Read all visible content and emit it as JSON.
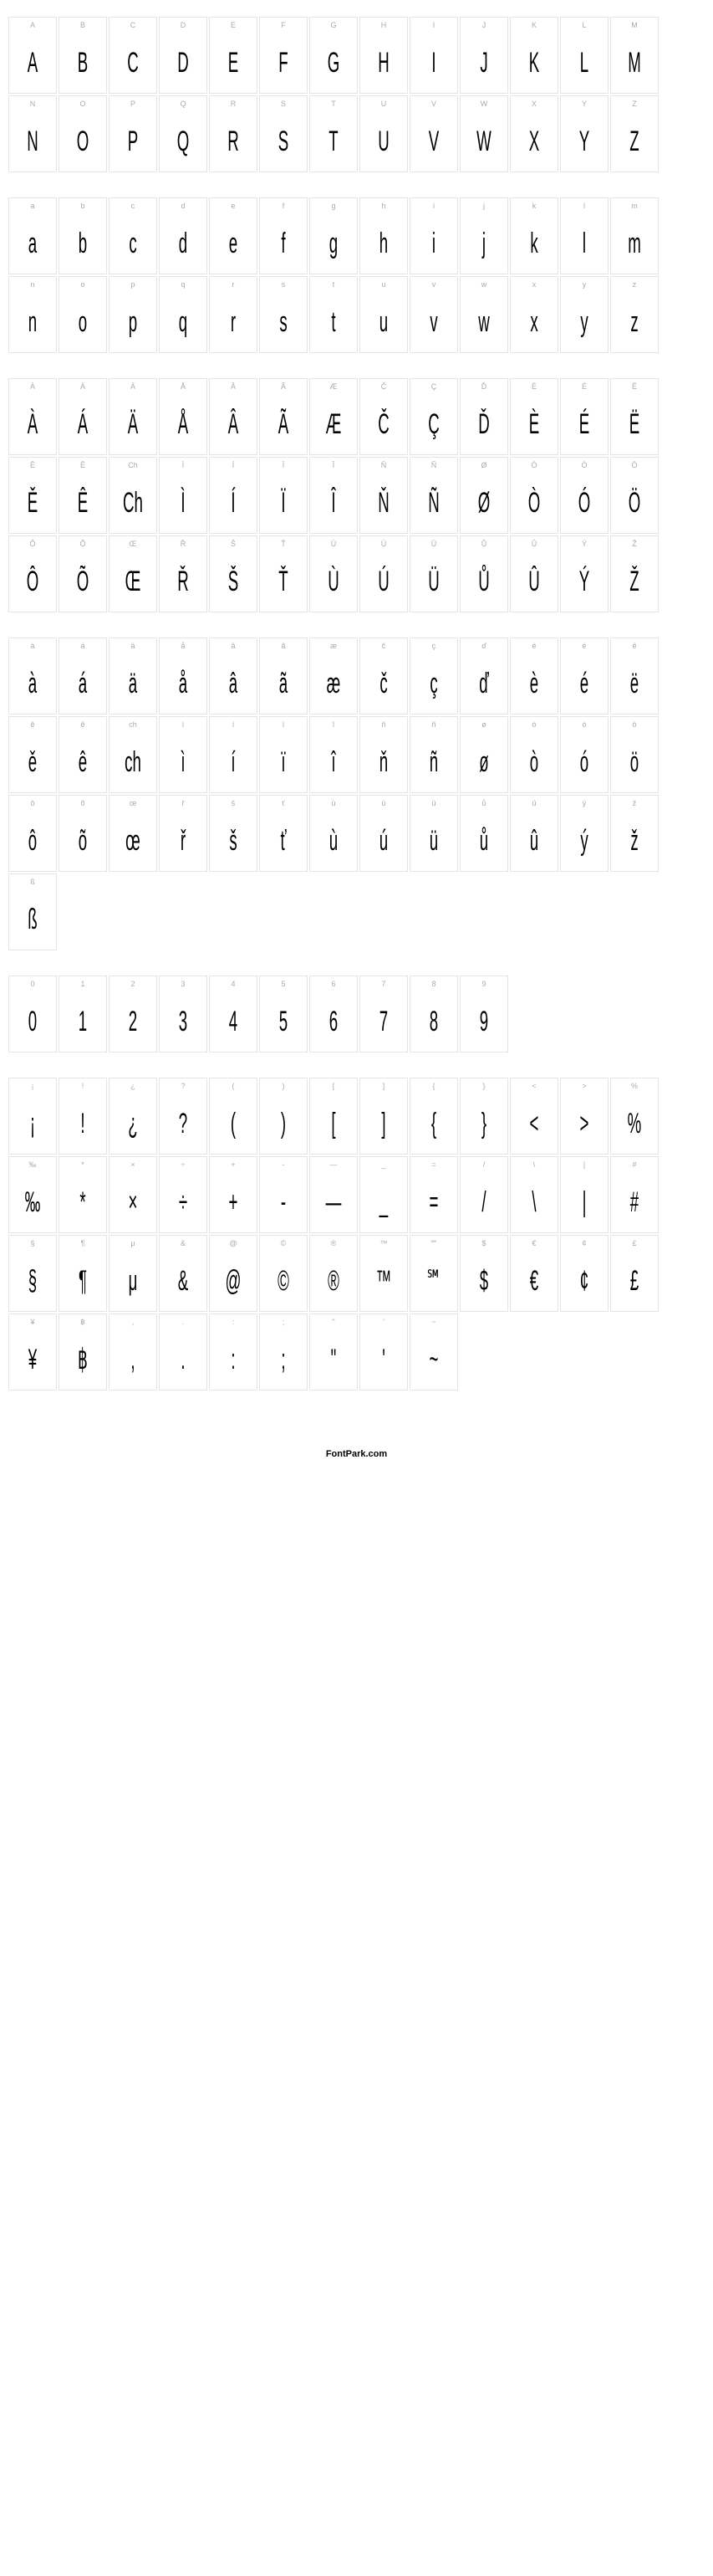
{
  "footer": "FontPark.com",
  "sections": [
    {
      "name": "uppercase",
      "chars": [
        {
          "label": "A",
          "glyph": "A"
        },
        {
          "label": "B",
          "glyph": "B"
        },
        {
          "label": "C",
          "glyph": "C"
        },
        {
          "label": "D",
          "glyph": "D"
        },
        {
          "label": "E",
          "glyph": "E"
        },
        {
          "label": "F",
          "glyph": "F"
        },
        {
          "label": "G",
          "glyph": "G"
        },
        {
          "label": "H",
          "glyph": "H"
        },
        {
          "label": "I",
          "glyph": "I"
        },
        {
          "label": "J",
          "glyph": "J"
        },
        {
          "label": "K",
          "glyph": "K"
        },
        {
          "label": "L",
          "glyph": "L"
        },
        {
          "label": "M",
          "glyph": "M"
        },
        {
          "label": "N",
          "glyph": "N"
        },
        {
          "label": "O",
          "glyph": "O"
        },
        {
          "label": "P",
          "glyph": "P"
        },
        {
          "label": "Q",
          "glyph": "Q"
        },
        {
          "label": "R",
          "glyph": "R"
        },
        {
          "label": "S",
          "glyph": "S"
        },
        {
          "label": "T",
          "glyph": "T"
        },
        {
          "label": "U",
          "glyph": "U"
        },
        {
          "label": "V",
          "glyph": "V"
        },
        {
          "label": "W",
          "glyph": "W"
        },
        {
          "label": "X",
          "glyph": "X"
        },
        {
          "label": "Y",
          "glyph": "Y"
        },
        {
          "label": "Z",
          "glyph": "Z"
        }
      ]
    },
    {
      "name": "lowercase",
      "chars": [
        {
          "label": "a",
          "glyph": "a"
        },
        {
          "label": "b",
          "glyph": "b"
        },
        {
          "label": "c",
          "glyph": "c"
        },
        {
          "label": "d",
          "glyph": "d"
        },
        {
          "label": "e",
          "glyph": "e"
        },
        {
          "label": "f",
          "glyph": "f"
        },
        {
          "label": "g",
          "glyph": "g"
        },
        {
          "label": "h",
          "glyph": "h"
        },
        {
          "label": "i",
          "glyph": "i"
        },
        {
          "label": "j",
          "glyph": "j"
        },
        {
          "label": "k",
          "glyph": "k"
        },
        {
          "label": "l",
          "glyph": "l"
        },
        {
          "label": "m",
          "glyph": "m"
        },
        {
          "label": "n",
          "glyph": "n"
        },
        {
          "label": "o",
          "glyph": "o"
        },
        {
          "label": "p",
          "glyph": "p"
        },
        {
          "label": "q",
          "glyph": "q"
        },
        {
          "label": "r",
          "glyph": "r"
        },
        {
          "label": "s",
          "glyph": "s"
        },
        {
          "label": "t",
          "glyph": "t"
        },
        {
          "label": "u",
          "glyph": "u"
        },
        {
          "label": "v",
          "glyph": "v"
        },
        {
          "label": "w",
          "glyph": "w"
        },
        {
          "label": "x",
          "glyph": "x"
        },
        {
          "label": "y",
          "glyph": "y"
        },
        {
          "label": "z",
          "glyph": "z"
        }
      ]
    },
    {
      "name": "uppercase-accented",
      "chars": [
        {
          "label": "À",
          "glyph": "À"
        },
        {
          "label": "Á",
          "glyph": "Á"
        },
        {
          "label": "Ä",
          "glyph": "Ä"
        },
        {
          "label": "Å",
          "glyph": "Å"
        },
        {
          "label": "Â",
          "glyph": "Â"
        },
        {
          "label": "Ã",
          "glyph": "Ã"
        },
        {
          "label": "Æ",
          "glyph": "Æ"
        },
        {
          "label": "Č",
          "glyph": "Č"
        },
        {
          "label": "Ç",
          "glyph": "Ç"
        },
        {
          "label": "Ď",
          "glyph": "Ď"
        },
        {
          "label": "È",
          "glyph": "È"
        },
        {
          "label": "É",
          "glyph": "É"
        },
        {
          "label": "Ë",
          "glyph": "Ë"
        },
        {
          "label": "Ě",
          "glyph": "Ě"
        },
        {
          "label": "Ê",
          "glyph": "Ê"
        },
        {
          "label": "Ch",
          "glyph": "Ch"
        },
        {
          "label": "Ì",
          "glyph": "Ì"
        },
        {
          "label": "Í",
          "glyph": "Í"
        },
        {
          "label": "Ï",
          "glyph": "Ï"
        },
        {
          "label": "Î",
          "glyph": "Î"
        },
        {
          "label": "Ň",
          "glyph": "Ň"
        },
        {
          "label": "Ñ",
          "glyph": "Ñ"
        },
        {
          "label": "Ø",
          "glyph": "Ø"
        },
        {
          "label": "Ò",
          "glyph": "Ò"
        },
        {
          "label": "Ó",
          "glyph": "Ó"
        },
        {
          "label": "Ö",
          "glyph": "Ö"
        },
        {
          "label": "Ô",
          "glyph": "Ô"
        },
        {
          "label": "Õ",
          "glyph": "Õ"
        },
        {
          "label": "Œ",
          "glyph": "Œ"
        },
        {
          "label": "Ř",
          "glyph": "Ř"
        },
        {
          "label": "Š",
          "glyph": "Š"
        },
        {
          "label": "Ť",
          "glyph": "Ť"
        },
        {
          "label": "Ù",
          "glyph": "Ù"
        },
        {
          "label": "Ú",
          "glyph": "Ú"
        },
        {
          "label": "Ü",
          "glyph": "Ü"
        },
        {
          "label": "Ů",
          "glyph": "Ů"
        },
        {
          "label": "Û",
          "glyph": "Û"
        },
        {
          "label": "Ý",
          "glyph": "Ý"
        },
        {
          "label": "Ž",
          "glyph": "Ž"
        }
      ]
    },
    {
      "name": "lowercase-accented",
      "chars": [
        {
          "label": "à",
          "glyph": "à"
        },
        {
          "label": "á",
          "glyph": "á"
        },
        {
          "label": "ä",
          "glyph": "ä"
        },
        {
          "label": "å",
          "glyph": "å"
        },
        {
          "label": "â",
          "glyph": "â"
        },
        {
          "label": "ã",
          "glyph": "ã"
        },
        {
          "label": "æ",
          "glyph": "æ"
        },
        {
          "label": "č",
          "glyph": "č"
        },
        {
          "label": "ç",
          "glyph": "ç"
        },
        {
          "label": "ď",
          "glyph": "ď"
        },
        {
          "label": "è",
          "glyph": "è"
        },
        {
          "label": "é",
          "glyph": "é"
        },
        {
          "label": "ë",
          "glyph": "ë"
        },
        {
          "label": "ě",
          "glyph": "ě"
        },
        {
          "label": "ê",
          "glyph": "ê"
        },
        {
          "label": "ch",
          "glyph": "ch"
        },
        {
          "label": "ì",
          "glyph": "ì"
        },
        {
          "label": "í",
          "glyph": "í"
        },
        {
          "label": "ï",
          "glyph": "ï"
        },
        {
          "label": "î",
          "glyph": "î"
        },
        {
          "label": "ň",
          "glyph": "ň"
        },
        {
          "label": "ñ",
          "glyph": "ñ"
        },
        {
          "label": "ø",
          "glyph": "ø"
        },
        {
          "label": "ò",
          "glyph": "ò"
        },
        {
          "label": "ó",
          "glyph": "ó"
        },
        {
          "label": "ö",
          "glyph": "ö"
        },
        {
          "label": "ô",
          "glyph": "ô"
        },
        {
          "label": "õ",
          "glyph": "õ"
        },
        {
          "label": "œ",
          "glyph": "œ"
        },
        {
          "label": "ř",
          "glyph": "ř"
        },
        {
          "label": "š",
          "glyph": "š"
        },
        {
          "label": "ť",
          "glyph": "ť"
        },
        {
          "label": "ù",
          "glyph": "ù"
        },
        {
          "label": "ú",
          "glyph": "ú"
        },
        {
          "label": "ü",
          "glyph": "ü"
        },
        {
          "label": "ů",
          "glyph": "ů"
        },
        {
          "label": "û",
          "glyph": "û"
        },
        {
          "label": "ý",
          "glyph": "ý"
        },
        {
          "label": "ž",
          "glyph": "ž"
        },
        {
          "label": "ß",
          "glyph": "ß"
        }
      ]
    },
    {
      "name": "digits",
      "chars": [
        {
          "label": "0",
          "glyph": "0"
        },
        {
          "label": "1",
          "glyph": "1"
        },
        {
          "label": "2",
          "glyph": "2"
        },
        {
          "label": "3",
          "glyph": "3"
        },
        {
          "label": "4",
          "glyph": "4"
        },
        {
          "label": "5",
          "glyph": "5"
        },
        {
          "label": "6",
          "glyph": "6"
        },
        {
          "label": "7",
          "glyph": "7"
        },
        {
          "label": "8",
          "glyph": "8"
        },
        {
          "label": "9",
          "glyph": "9"
        }
      ]
    },
    {
      "name": "punctuation",
      "chars": [
        {
          "label": "¡",
          "glyph": "¡"
        },
        {
          "label": "!",
          "glyph": "!"
        },
        {
          "label": "¿",
          "glyph": "¿"
        },
        {
          "label": "?",
          "glyph": "?"
        },
        {
          "label": "(",
          "glyph": "("
        },
        {
          "label": ")",
          "glyph": ")"
        },
        {
          "label": "[",
          "glyph": "["
        },
        {
          "label": "]",
          "glyph": "]"
        },
        {
          "label": "{",
          "glyph": "{"
        },
        {
          "label": "}",
          "glyph": "}"
        },
        {
          "label": "<",
          "glyph": "<"
        },
        {
          "label": ">",
          "glyph": ">"
        },
        {
          "label": "%",
          "glyph": "%"
        },
        {
          "label": "‰",
          "glyph": "‰"
        },
        {
          "label": "*",
          "glyph": "*"
        },
        {
          "label": "×",
          "glyph": "×"
        },
        {
          "label": "÷",
          "glyph": "÷"
        },
        {
          "label": "+",
          "glyph": "+"
        },
        {
          "label": "-",
          "glyph": "-"
        },
        {
          "label": "—",
          "glyph": "—"
        },
        {
          "label": "_",
          "glyph": "_"
        },
        {
          "label": "=",
          "glyph": "="
        },
        {
          "label": "/",
          "glyph": "/"
        },
        {
          "label": "\\",
          "glyph": "\\"
        },
        {
          "label": "|",
          "glyph": "|"
        },
        {
          "label": "#",
          "glyph": "#"
        },
        {
          "label": "§",
          "glyph": "§"
        },
        {
          "label": "¶",
          "glyph": "¶"
        },
        {
          "label": "μ",
          "glyph": "μ"
        },
        {
          "label": "&",
          "glyph": "&"
        },
        {
          "label": "@",
          "glyph": "@"
        },
        {
          "label": "©",
          "glyph": "©"
        },
        {
          "label": "®",
          "glyph": "®"
        },
        {
          "label": "™",
          "glyph": "™"
        },
        {
          "label": "℠",
          "glyph": "℠"
        },
        {
          "label": "$",
          "glyph": "$"
        },
        {
          "label": "€",
          "glyph": "€"
        },
        {
          "label": "¢",
          "glyph": "¢"
        },
        {
          "label": "£",
          "glyph": "£"
        },
        {
          "label": "¥",
          "glyph": "¥"
        },
        {
          "label": "฿",
          "glyph": "฿"
        },
        {
          "label": ",",
          "glyph": ","
        },
        {
          "label": ".",
          "glyph": "."
        },
        {
          "label": ":",
          "glyph": ":"
        },
        {
          "label": ";",
          "glyph": ";"
        },
        {
          "label": "\"",
          "glyph": "\""
        },
        {
          "label": "'",
          "glyph": "'"
        },
        {
          "label": "~",
          "glyph": "~"
        }
      ]
    }
  ]
}
